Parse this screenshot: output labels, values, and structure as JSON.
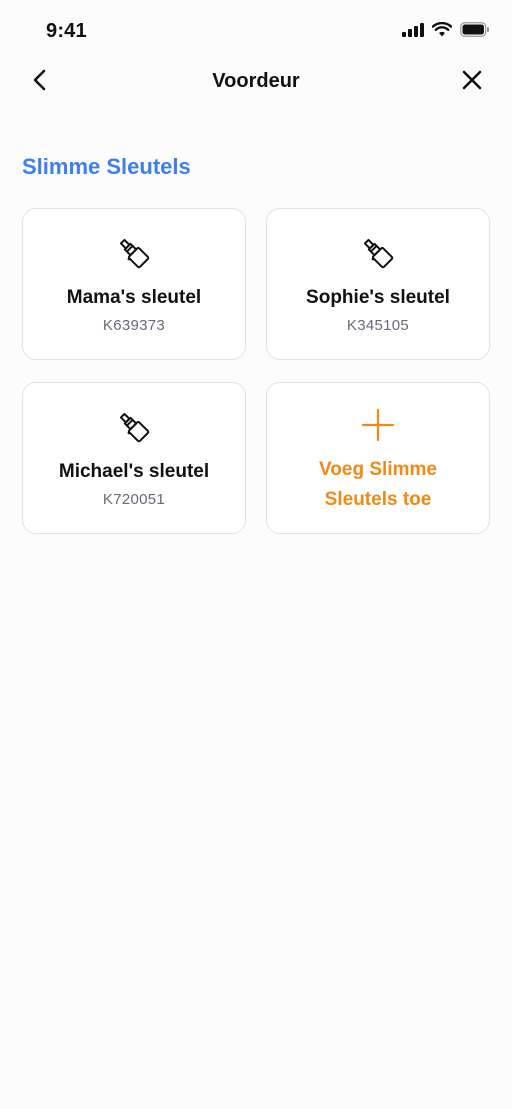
{
  "status_bar": {
    "time": "9:41",
    "icons": [
      "signal-icon",
      "wifi-icon",
      "battery-icon"
    ]
  },
  "nav": {
    "title": "Voordeur",
    "back_icon": "chevron-left-icon",
    "close_icon": "close-icon"
  },
  "section": {
    "title": "Slimme Sleutels"
  },
  "keys": [
    {
      "name": "Mama's sleutel",
      "code": "K639373",
      "icon": "key-icon"
    },
    {
      "name": "Sophie's sleutel",
      "code": "K345105",
      "icon": "key-icon"
    },
    {
      "name": "Michael's sleutel",
      "code": "K720051",
      "icon": "key-icon"
    }
  ],
  "add_card": {
    "label": "Voeg Slimme Sleutels toe",
    "icon": "plus-icon"
  },
  "colors": {
    "accent_blue": "#3d7ef0",
    "accent_orange": "#f08a13",
    "text_primary": "#111111",
    "text_secondary": "#6a6878",
    "card_border": "#e3e1e6",
    "background": "#fdfcfd"
  }
}
